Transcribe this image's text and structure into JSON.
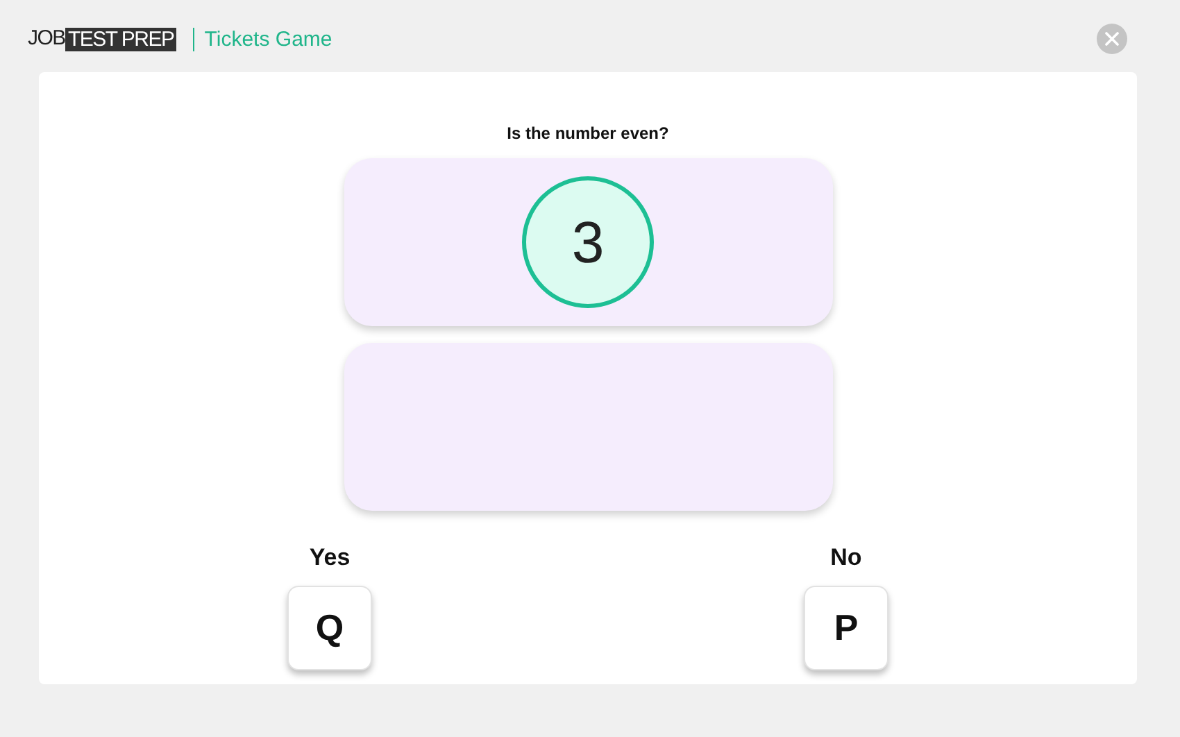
{
  "header": {
    "logo_left": "JOB",
    "logo_right": "TEST PREP",
    "title": "Tickets Game"
  },
  "question": "Is the number even?",
  "tickets": [
    {
      "kind": "number",
      "value": "3"
    },
    {
      "kind": "empty"
    }
  ],
  "answers": [
    {
      "label": "Yes",
      "key": "Q"
    },
    {
      "label": "No",
      "key": "P"
    }
  ]
}
